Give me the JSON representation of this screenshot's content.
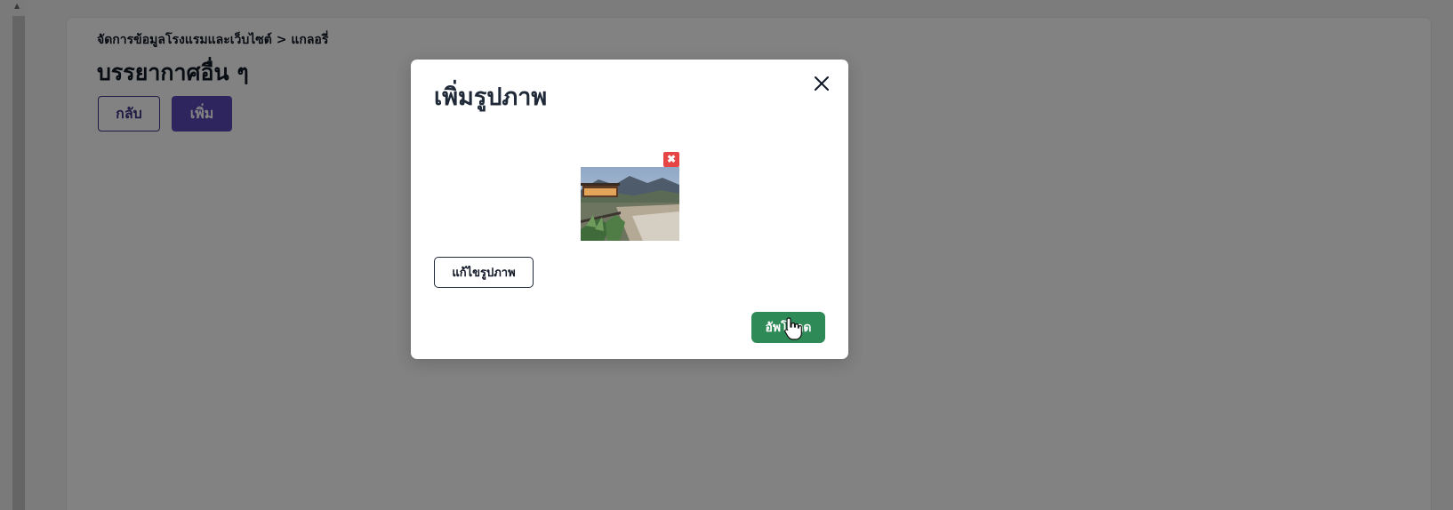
{
  "page": {
    "breadcrumb": "จัดการข้อมูลโรงแรมและเว็บไซต์ > แกลอรี่",
    "title": "บรรยากาศอื่น ๆ",
    "back_label": "กลับ",
    "add_label": "เพิ่ม"
  },
  "modal": {
    "title": "เพิ่มรูปภาพ",
    "close_icon": "close-icon",
    "remove_image_icon": "remove-image-icon",
    "edit_image_label": "แก้ไขรูปภาพ",
    "upload_label": "อัพโหลด"
  },
  "colors": {
    "primary": "#5b47b9",
    "primary_dark": "#3b3486",
    "upload_green": "#2e8b57",
    "remove_red": "#e64545",
    "overlay": "rgba(0,0,0,0.49)"
  }
}
